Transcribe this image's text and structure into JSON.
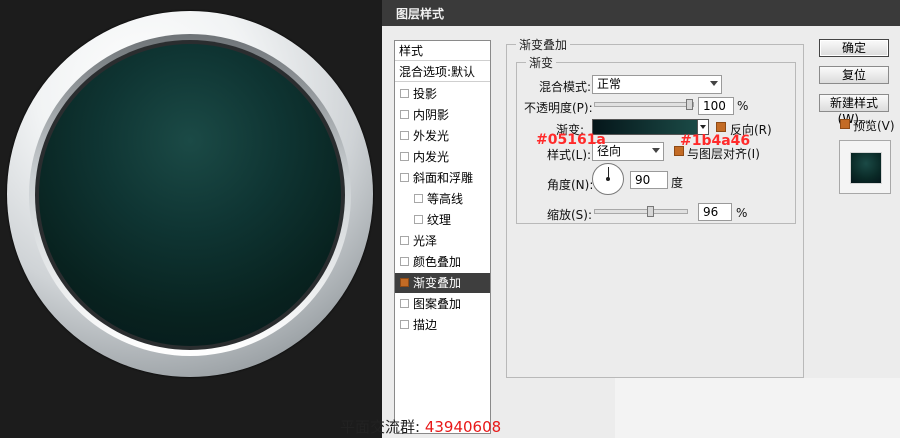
{
  "dialog": {
    "title": "图层样式"
  },
  "style_list": {
    "header": "样式",
    "blend_options": "混合选项:默认",
    "items": [
      {
        "label": "投影",
        "checked": false
      },
      {
        "label": "内阴影",
        "checked": false
      },
      {
        "label": "外发光",
        "checked": false
      },
      {
        "label": "内发光",
        "checked": false
      },
      {
        "label": "斜面和浮雕",
        "checked": false
      },
      {
        "label": "等高线",
        "checked": false
      },
      {
        "label": "纹理",
        "checked": false
      },
      {
        "label": "光泽",
        "checked": false
      },
      {
        "label": "颜色叠加",
        "checked": false
      },
      {
        "label": "渐变叠加",
        "checked": true
      },
      {
        "label": "图案叠加",
        "checked": false
      },
      {
        "label": "描边",
        "checked": false
      }
    ]
  },
  "panel": {
    "group_title": "渐变叠加",
    "subgroup_title": "渐变",
    "blend_mode_label": "混合模式:",
    "blend_mode_value": "正常",
    "opacity_label": "不透明度(P):",
    "opacity_value": "100",
    "opacity_unit": "%",
    "gradient_label": "渐变:",
    "reverse_label": "反向(R)",
    "style_label": "样式(L):",
    "style_value": "径向",
    "align_label": "与图层对齐(I)",
    "angle_label": "角度(N):",
    "angle_value": "90",
    "angle_unit": "度",
    "scale_label": "缩放(S):",
    "scale_value": "96",
    "scale_unit": "%"
  },
  "buttons": {
    "ok": "确定",
    "reset": "复位",
    "new_style": "新建样式(W)...",
    "preview_label": "预览(V)"
  },
  "annotations": {
    "color_start": "#05161a",
    "color_end": "#1b4a46"
  },
  "footer": {
    "text": "平面交流群:",
    "qq": "43940608"
  },
  "colors": {
    "gradient_start": "#05161a",
    "gradient_end": "#1b4a46",
    "checkbox_accent": "#c36b25",
    "annotation_red": "#ff2a2a"
  }
}
